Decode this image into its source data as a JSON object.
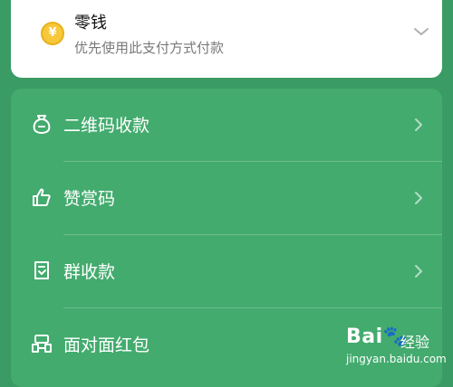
{
  "payment": {
    "title": "零钱",
    "subtitle": "优先使用此支付方式付款",
    "coin_symbol": "¥"
  },
  "menu": {
    "items": [
      {
        "label": "二维码收款",
        "icon": "money-bag-icon"
      },
      {
        "label": "赞赏码",
        "icon": "thumbs-up-icon"
      },
      {
        "label": "群收款",
        "icon": "group-receipt-icon"
      },
      {
        "label": "面对面红包",
        "icon": "face-to-face-envelope-icon"
      }
    ]
  },
  "watermark": {
    "logo": "Bai🐾",
    "text": "经验",
    "url": "jingyan.baidu.com"
  },
  "colors": {
    "background": "#3a9b64",
    "panel": "#43ab6e",
    "card": "#ffffff",
    "coin": "#f6c83a"
  }
}
